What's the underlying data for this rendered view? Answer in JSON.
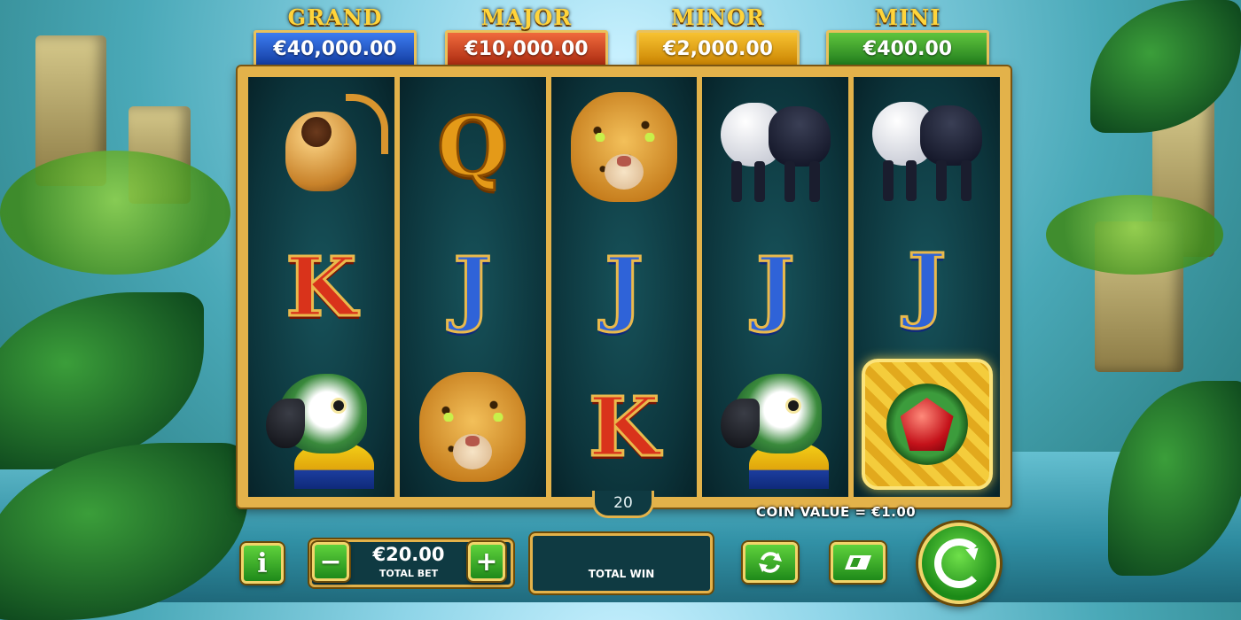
{
  "jackpots": [
    {
      "id": "grand",
      "title": "GRAND",
      "value": "€40,000.00"
    },
    {
      "id": "major",
      "title": "MAJOR",
      "value": "€10,000.00"
    },
    {
      "id": "minor",
      "title": "MINOR",
      "value": "€2,000.00"
    },
    {
      "id": "mini",
      "title": "MINI",
      "value": "€400.00"
    }
  ],
  "reels": [
    [
      "golden-monkey",
      "K",
      "parrot"
    ],
    [
      "Q",
      "J",
      "jaguar"
    ],
    [
      "jaguar",
      "J",
      "K"
    ],
    [
      "tapir",
      "J",
      "parrot"
    ],
    [
      "tapir",
      "J",
      "jewel-scatter"
    ]
  ],
  "paylines": "20",
  "coin_value": "COIN VALUE = €1.00",
  "bet": {
    "value": "€20.00",
    "label": "TOTAL BET",
    "minus": "−",
    "plus": "+"
  },
  "win": {
    "label": "TOTAL WIN"
  },
  "controls": {
    "info": "i",
    "autoplay_icon": "autoplay-icon",
    "turbo_icon": "turbo-icon",
    "spin_icon": "spin-icon"
  },
  "colors": {
    "frame_gold": "#e3b24a",
    "reel_bg": "#0c343b",
    "button_green": "#2f9a22"
  }
}
